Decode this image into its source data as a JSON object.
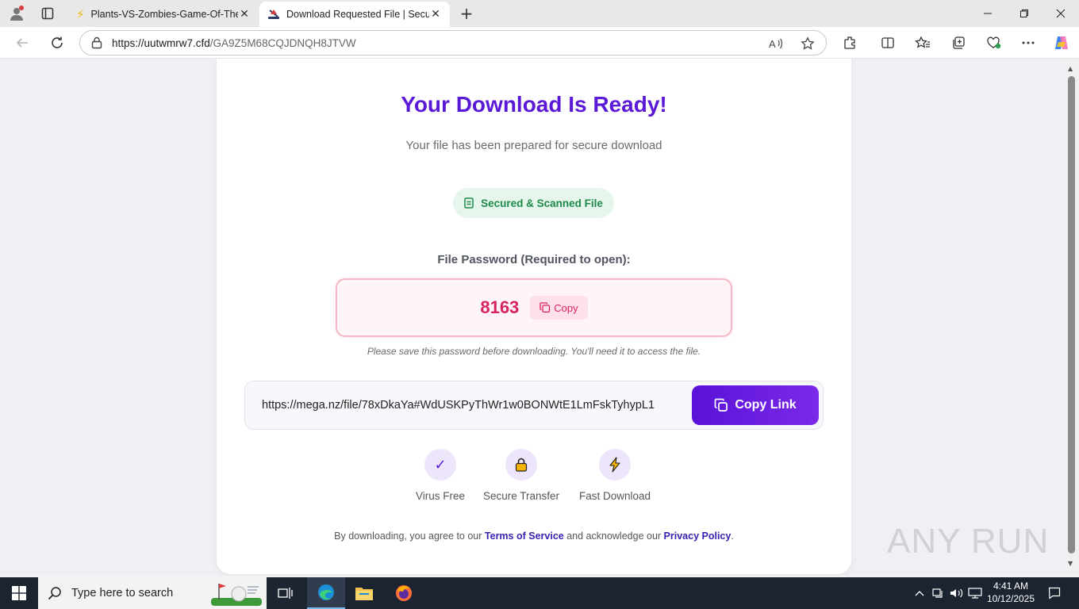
{
  "browser": {
    "tabs": [
      {
        "title": "Plants-VS-Zombies-Game-Of-The",
        "icon": "lightning-icon",
        "active": false
      },
      {
        "title": "Download Requested File | Secure",
        "icon": "site-favicon",
        "active": true
      }
    ],
    "url_domain": "https://uutwmrw7.cfd",
    "url_path": "/GA9Z5M68CQJDNQH8JTVW"
  },
  "page": {
    "title": "Your Download Is Ready!",
    "subtitle": "Your file has been prepared for secure download",
    "badge": "Secured & Scanned File",
    "password_label": "File Password (Required to open):",
    "password_value": "8163",
    "password_copy_label": "Copy",
    "password_note": "Please save this password before downloading. You'll need it to access the file.",
    "download_link": "https://mega.nz/file/78xDkaYa#WdUSKPyThWr1w0BONWtE1LmFskTyhypL1",
    "copy_link_label": "Copy Link",
    "features": [
      {
        "icon": "checkmark-icon",
        "label": "Virus Free"
      },
      {
        "icon": "lock-icon",
        "label": "Secure Transfer"
      },
      {
        "icon": "lightning-icon",
        "label": "Fast Download"
      }
    ],
    "terms_prefix": "By downloading, you agree to our",
    "terms_link": "Terms of Service",
    "terms_middle": "and acknowledge our",
    "privacy_link": "Privacy Policy",
    "terms_suffix": "."
  },
  "watermark": "ANY RUN",
  "taskbar": {
    "search_placeholder": "Type here to search",
    "time": "4:41 AM",
    "date": "10/12/2025"
  },
  "colors": {
    "accent": "#5a19d6",
    "password": "#d7245e",
    "secure_green": "#1d8a4a"
  }
}
